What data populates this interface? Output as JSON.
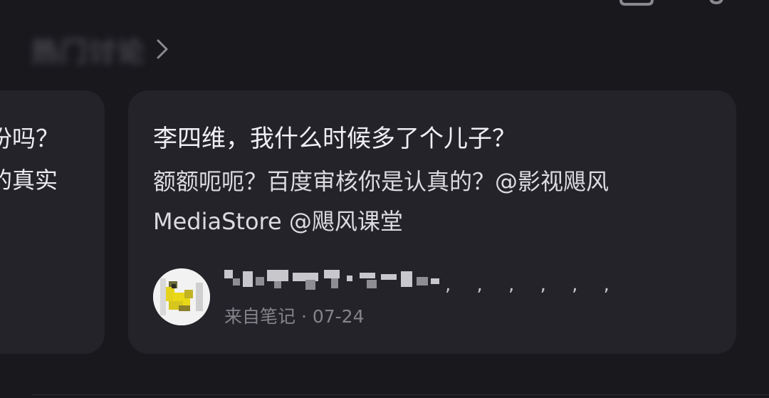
{
  "section": {
    "title": "热门讨论",
    "chevron_icon": "chevron-right-icon"
  },
  "top_icons": [
    "copy-icon",
    "notification-icon"
  ],
  "prev_card": {
    "line1": "份吗？",
    "line2": "的真实"
  },
  "main_card": {
    "title": "李四维，我什么时候多了个儿子？",
    "body_line1": "额额呃呃？百度审核你是认真的？@影视飓风",
    "body_line2": "MediaStore @飓风课堂",
    "author": {
      "name": "",
      "trailing": ", , , , , ,",
      "meta": "来自笔记 · 07-24",
      "avatar_icon": "duck-avatar-icon"
    }
  },
  "colors": {
    "background": "#19181d",
    "card": "#242329",
    "text_primary": "#f0eff3",
    "text_secondary": "#85848b"
  }
}
